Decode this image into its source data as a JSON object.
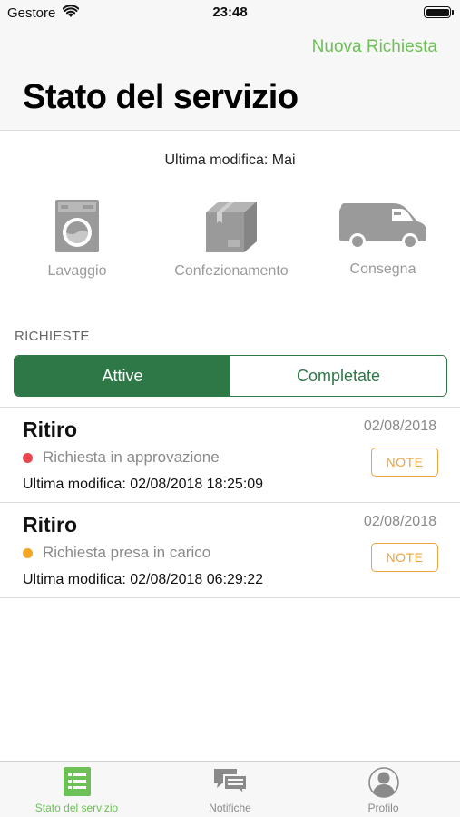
{
  "status_bar": {
    "carrier": "Gestore",
    "time": "23:48"
  },
  "header": {
    "action_label": "Nuova Richiesta",
    "title": "Stato del servizio"
  },
  "last_modified": "Ultima modifica: Mai",
  "stages": [
    {
      "label": "Lavaggio",
      "icon": "washing-machine-icon"
    },
    {
      "label": "Confezionamento",
      "icon": "box-icon"
    },
    {
      "label": "Consegna",
      "icon": "van-icon"
    }
  ],
  "section_label": "RICHIESTE",
  "segments": {
    "active": "Attive",
    "completed": "Completate"
  },
  "requests": [
    {
      "title": "Ritiro",
      "date": "02/08/2018",
      "status": "Richiesta in approvazione",
      "status_color": "#e8454c",
      "modified": "Ultima modifica: 02/08/2018 18:25:09",
      "note_label": "NOTE"
    },
    {
      "title": "Ritiro",
      "date": "02/08/2018",
      "status": "Richiesta presa in carico",
      "status_color": "#f5a623",
      "modified": "Ultima modifica: 02/08/2018 06:29:22",
      "note_label": "NOTE"
    }
  ],
  "tabs": [
    {
      "label": "Stato del servizio",
      "icon": "list-icon",
      "active": true
    },
    {
      "label": "Notifiche",
      "icon": "chat-bubbles-icon",
      "active": false
    },
    {
      "label": "Profilo",
      "icon": "user-icon",
      "active": false
    }
  ],
  "colors": {
    "accent": "#6cc055",
    "segment_green": "#2e7747",
    "note_orange": "#f0a13b"
  }
}
